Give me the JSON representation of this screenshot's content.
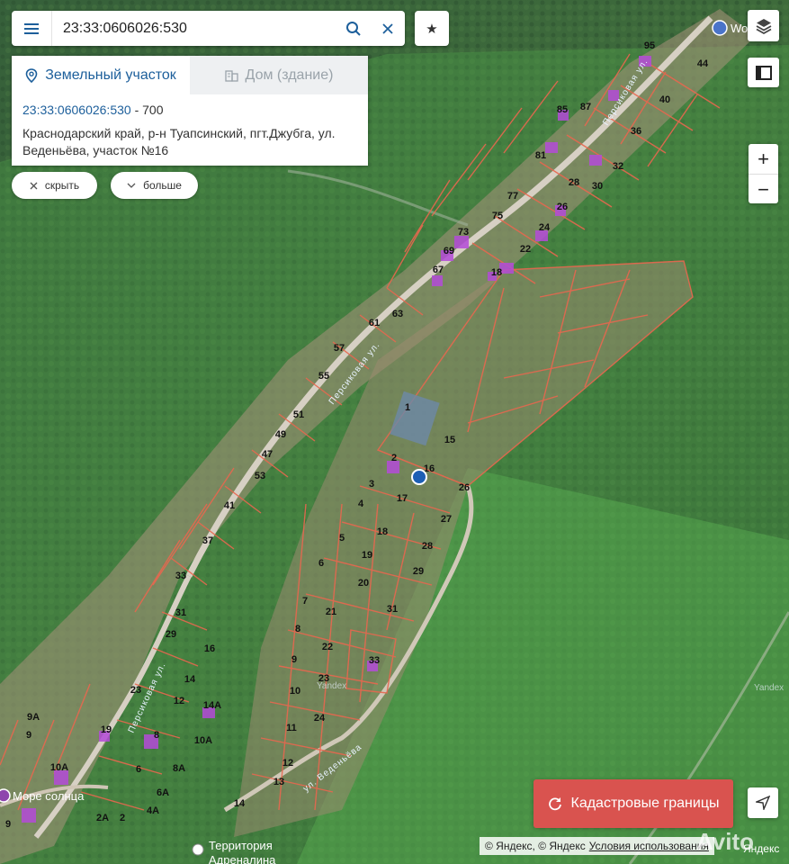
{
  "search": {
    "value": "23:33:0606026:530"
  },
  "info_panel": {
    "tabs": [
      {
        "label": "Земельный участок",
        "active": true
      },
      {
        "label": "Дом (здание)",
        "active": false
      }
    ],
    "cadastral_number": "23:33:0606026:530",
    "area_sep": " - ",
    "area": "700",
    "address": "Краснодарский край, р-н Туапсинский, пгт.Джубга, ул. Веденьёва, участок №16"
  },
  "actions": {
    "hide_label": "скрыть",
    "more_label": "больше"
  },
  "zoom": {
    "in_label": "+",
    "out_label": "−"
  },
  "cadastral_button": {
    "label": "Кадастровые границы"
  },
  "copyright": {
    "text1": "© Яндекс, © Яндекс",
    "terms_link": "Условия использования"
  },
  "watermark": "Avito",
  "brand": "Яндекс",
  "map": {
    "streets": [
      "Персиковая ул.",
      "Персиковая ул.",
      "Персиковая ул.",
      "ул. Веденьёва"
    ],
    "pois": [
      "Море солнца",
      "Территория Адреналина",
      "Wo"
    ],
    "map_watermarks": [
      "Yandex",
      "Yandex"
    ],
    "plot_labels": [
      "95",
      "44",
      "40",
      "36",
      "32",
      "30",
      "28",
      "26",
      "24",
      "22",
      "87",
      "85",
      "81",
      "77",
      "75",
      "73",
      "69",
      "67",
      "18",
      "63",
      "61",
      "57",
      "55",
      "51",
      "49",
      "47",
      "53",
      "41",
      "37",
      "33",
      "31",
      "29",
      "16",
      "14",
      "14А",
      "12",
      "10А",
      "8",
      "8А",
      "6",
      "6А",
      "4А",
      "2А",
      "2",
      "9А",
      "9",
      "10А",
      "19",
      "23",
      "1",
      "2",
      "15",
      "16",
      "26",
      "3",
      "17",
      "4",
      "18",
      "27",
      "5",
      "28",
      "6",
      "19",
      "20",
      "29",
      "7",
      "21",
      "31",
      "8",
      "22",
      "9",
      "23",
      "33",
      "10",
      "24",
      "11",
      "12",
      "13",
      "14",
      "9"
    ]
  },
  "colors": {
    "brand_blue": "#1d5f9b",
    "cadastral_red": "#d9534f",
    "zone_green": "#4caf50",
    "parcel_line": "#e8674f",
    "building": "#b44bd8"
  }
}
